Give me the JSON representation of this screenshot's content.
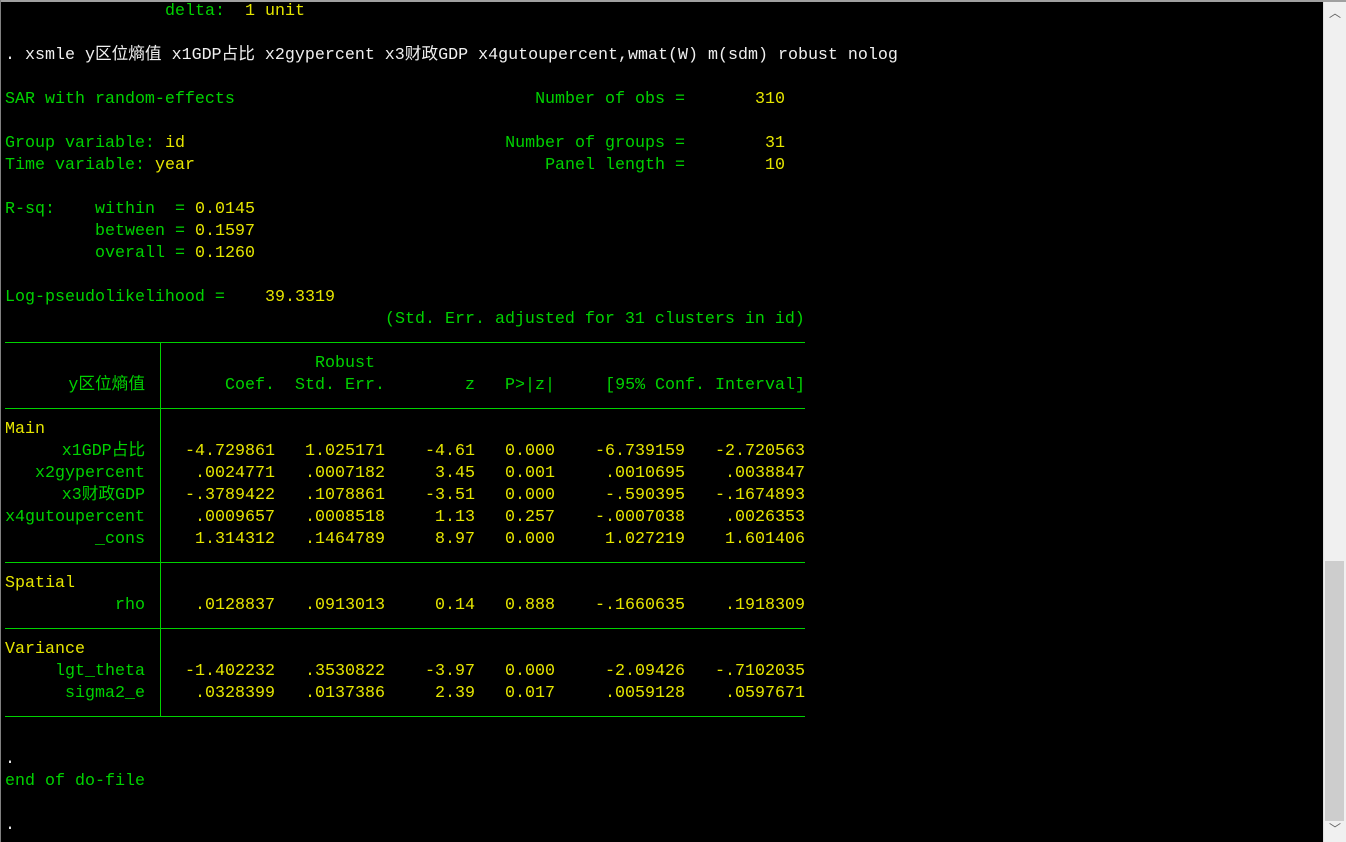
{
  "preamble": {
    "delta_label": "delta:",
    "delta_value": "1 unit"
  },
  "command": ". xsmle y区位熵值 x1GDP占比 x2gypercent x3财政GDP x4gutoupercent,wmat(W) m(sdm) robust nolog",
  "model": {
    "title": "SAR with random-effects",
    "nobs_label": "Number of obs =",
    "nobs": "310",
    "group_label": "Group variable:",
    "group_var": "id",
    "ngroups_label": "Number of groups =",
    "ngroups": "31",
    "time_label": "Time variable:",
    "time_var": "year",
    "panel_label": "Panel length =",
    "panel_length": "10",
    "rsq_label": "R-sq:",
    "within_label": "within  =",
    "within": "0.0145",
    "between_label": "between =",
    "between": "0.1597",
    "overall_label": "overall =",
    "overall": "0.1260",
    "ll_label": "Log-pseudolikelihood =",
    "ll": "39.3319",
    "cluster_note": "(Std. Err. adjusted for 31 clusters in id)"
  },
  "table": {
    "header": {
      "robust": "Robust",
      "depvar": "y区位熵值",
      "coef": "Coef.",
      "se": "Std. Err.",
      "z": "z",
      "p": "P>|z|",
      "ci": "[95% Conf. Interval]"
    },
    "sections": [
      {
        "name": "Main",
        "rows": [
          {
            "var": "x1GDP占比",
            "coef": "-4.729861",
            "se": "1.025171",
            "z": "-4.61",
            "p": "0.000",
            "lo": "-6.739159",
            "hi": "-2.720563"
          },
          {
            "var": "x2gypercent",
            "coef": ".0024771",
            "se": ".0007182",
            "z": "3.45",
            "p": "0.001",
            "lo": ".0010695",
            "hi": ".0038847"
          },
          {
            "var": "x3财政GDP",
            "coef": "-.3789422",
            "se": ".1078861",
            "z": "-3.51",
            "p": "0.000",
            "lo": "-.590395",
            "hi": "-.1674893"
          },
          {
            "var": "x4gutoupercent",
            "coef": ".0009657",
            "se": ".0008518",
            "z": "1.13",
            "p": "0.257",
            "lo": "-.0007038",
            "hi": ".0026353"
          },
          {
            "var": "_cons",
            "coef": "1.314312",
            "se": ".1464789",
            "z": "8.97",
            "p": "0.000",
            "lo": "1.027219",
            "hi": "1.601406"
          }
        ]
      },
      {
        "name": "Spatial",
        "rows": [
          {
            "var": "rho",
            "coef": ".0128837",
            "se": ".0913013",
            "z": "0.14",
            "p": "0.888",
            "lo": "-.1660635",
            "hi": ".1918309"
          }
        ]
      },
      {
        "name": "Variance",
        "rows": [
          {
            "var": "lgt_theta",
            "coef": "-1.402232",
            "se": ".3530822",
            "z": "-3.97",
            "p": "0.000",
            "lo": "-2.09426",
            "hi": "-.7102035"
          },
          {
            "var": "sigma2_e",
            "coef": ".0328399",
            "se": ".0137386",
            "z": "2.39",
            "p": "0.017",
            "lo": ".0059128",
            "hi": ".0597671"
          }
        ]
      }
    ]
  },
  "footer": {
    "dot1": ".",
    "end": "end of do-file",
    "prompt": "."
  },
  "scrollbar": {
    "up": "︿",
    "down": "﹀",
    "position_fraction": 0.96
  }
}
